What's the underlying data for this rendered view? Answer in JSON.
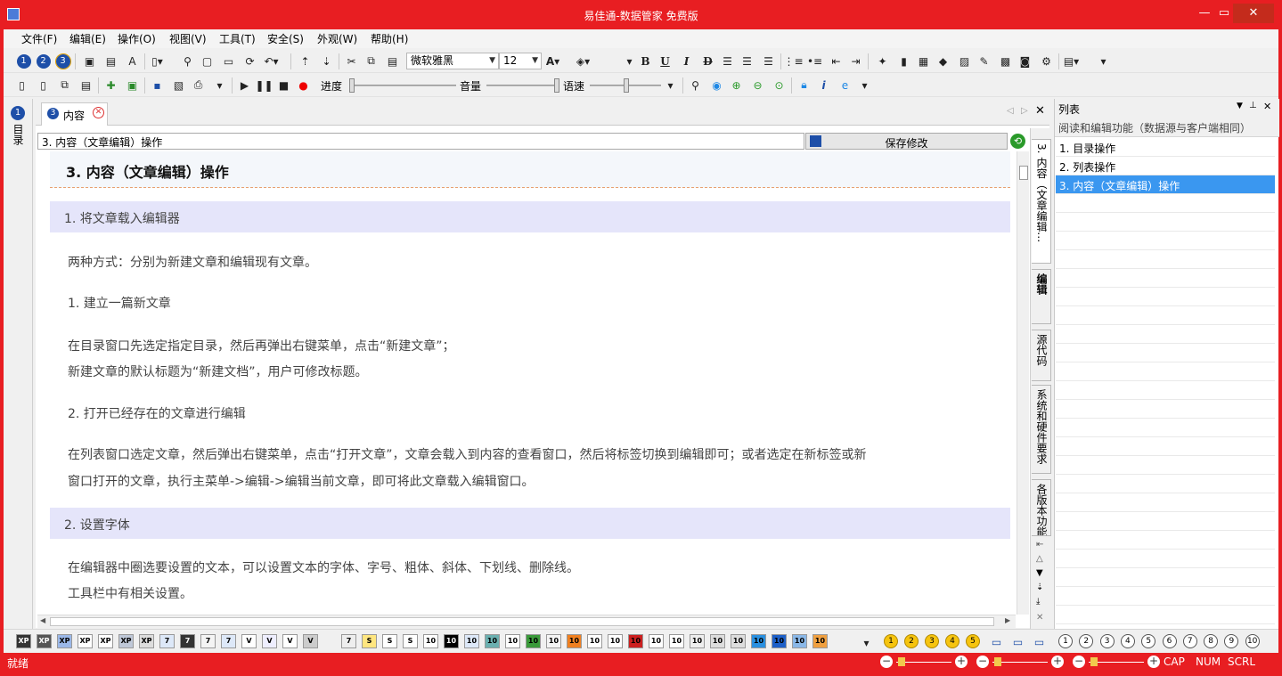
{
  "window": {
    "title": "易佳通-数据管家 免费版",
    "minimize": "—",
    "restore": "▭",
    "close": "✕"
  },
  "menu": [
    "文件(F)",
    "编辑(E)",
    "操作(O)",
    "视图(V)",
    "工具(T)",
    "安全(S)",
    "外观(W)",
    "帮助(H)"
  ],
  "toolbar": {
    "font_name": "微软雅黑",
    "font_size": "12",
    "progress_label": "进度",
    "volume_label": "音量",
    "speed_label": "语速"
  },
  "tab": {
    "label": "内容",
    "number": "3"
  },
  "editor": {
    "title_value": "3.  内容（文章编辑）操作",
    "save_button": "保存修改",
    "heading": "3. 内容（文章编辑）操作",
    "section1": "1.   将文章载入编辑器",
    "p1": "两种方式：分别为新建文章和编辑现有文章。",
    "p2": "1.   建立一篇新文章",
    "p3": "在目录窗口先选定指定目录，然后再弹出右键菜单，点击“新建文章”；",
    "p4": "新建文章的默认标题为“新建文档”，用户可修改标题。",
    "p5": "2.   打开已经存在的文章进行编辑",
    "p6": "在列表窗口选定文章，然后弹出右键菜单，点击“打开文章”，文章会载入到内容的查看窗口，然后将标签切换到编辑即可；或者选定在新标签或新",
    "p7": "窗口打开的文章，执行主菜单->编辑->编辑当前文章，即可将此文章载入编辑窗口。",
    "section2": "2.   设置字体",
    "p8": "在编辑器中圈选要设置的文本，可以设置文本的字体、字号、粗体、斜体、下划线、删除线。",
    "p9": "工具栏中有相关设置。"
  },
  "vtabs": [
    "3. 内容（文章编辑…",
    "编辑",
    "源代码",
    "系统和硬件要求",
    "各版本功能"
  ],
  "left_sidebar": {
    "label": "目录"
  },
  "list_panel": {
    "title": "列表",
    "subtitle": "阅读和编辑功能（数据源与客户端相同）",
    "items": [
      "1.  目录操作",
      "2.  列表操作",
      "3.  内容（文章编辑）操作"
    ],
    "selected_index": 2
  },
  "bottom_icons": [
    "XP",
    "XP",
    "XP",
    "XP",
    "XP",
    "XP",
    "XP",
    "7",
    "7",
    "7",
    "7",
    "V",
    "V",
    "V",
    "V",
    "7",
    "S",
    "S",
    "S",
    "10",
    "10",
    "10",
    "10",
    "10",
    "10",
    "10",
    "10",
    "10",
    "10",
    "10",
    "10",
    "10",
    "10",
    "10",
    "10",
    "10",
    "10",
    "10",
    "10"
  ],
  "bottom_circles": [
    "1",
    "2",
    "3",
    "4",
    "5"
  ],
  "bottom_right_circles": [
    "1",
    "2",
    "3",
    "4",
    "5",
    "6",
    "7",
    "8",
    "9",
    "10"
  ],
  "status": {
    "text": "就绪",
    "cap": "CAP",
    "num": "NUM",
    "scrl": "SCRL"
  },
  "colors": {
    "title_bar": "#e81e22",
    "selection": "#3a97f0",
    "section_bg": "#e5e5fa"
  }
}
